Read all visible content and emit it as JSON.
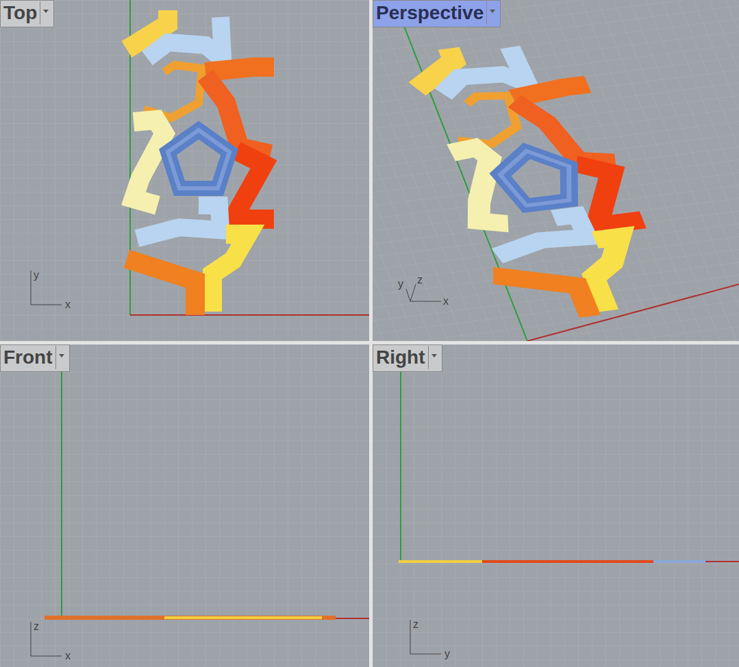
{
  "viewports": [
    {
      "label": "Top",
      "selected": false,
      "view": "top",
      "axes": [
        "y",
        "x"
      ]
    },
    {
      "label": "Perspective",
      "selected": true,
      "view": "perspective",
      "axes": [
        "y",
        "z",
        "x"
      ]
    },
    {
      "label": "Front",
      "selected": false,
      "view": "front",
      "axes": [
        "z",
        "x"
      ]
    },
    {
      "label": "Right",
      "selected": false,
      "view": "right",
      "axes": [
        "z",
        "y"
      ]
    }
  ]
}
